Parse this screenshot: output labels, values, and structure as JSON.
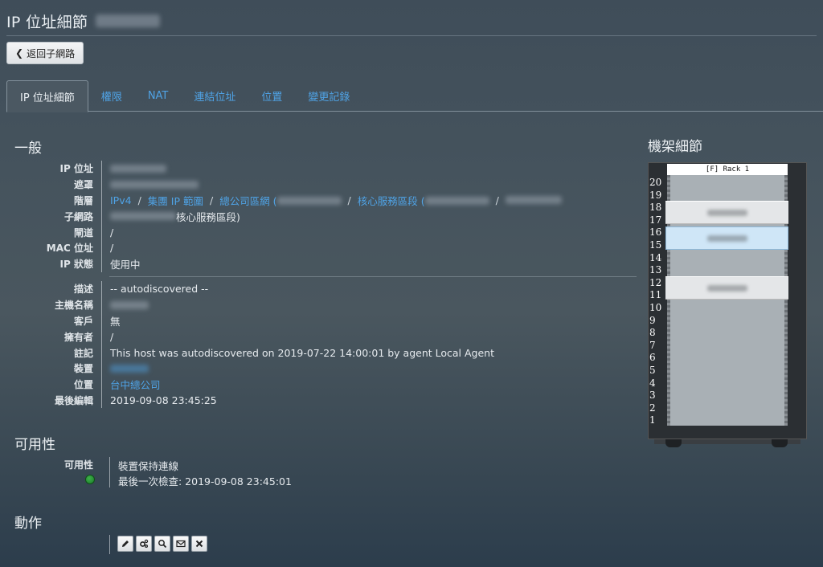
{
  "header": {
    "title": "IP 位址細節",
    "back_button_label": "返回子網路"
  },
  "tabs": [
    {
      "label": "IP 位址細節",
      "active": true
    },
    {
      "label": "權限",
      "active": false
    },
    {
      "label": "NAT",
      "active": false
    },
    {
      "label": "連結位址",
      "active": false
    },
    {
      "label": "位置",
      "active": false
    },
    {
      "label": "變更記錄",
      "active": false
    }
  ],
  "general": {
    "heading": "一般",
    "fields": {
      "ip_label": "IP 位址",
      "mask_label": "遮罩",
      "hierarchy_label": "階層",
      "subnet_label": "子網路",
      "gateway_label": "閘道",
      "gateway_value": "/",
      "mac_label": "MAC 位址",
      "mac_value": "/",
      "ipstate_label": "IP 狀態",
      "ipstate_value": "使用中",
      "description_label": "描述",
      "description_value": "-- autodiscovered --",
      "hostname_label": "主機名稱",
      "customer_label": "客戶",
      "customer_value": "無",
      "owner_label": "擁有者",
      "owner_value": "/",
      "note_label": "註記",
      "note_value": "This host was autodiscovered on 2019-07-22 14:00:01 by agent Local Agent",
      "device_label": "裝置",
      "location_label": "位置",
      "location_value": "台中總公司",
      "lastedit_label": "最後編輯",
      "lastedit_value": "2019-09-08 23:45:25"
    },
    "hierarchy": {
      "item1": "IPv4",
      "item2": "集團 IP 範圍",
      "item3": "總公司區網 (",
      "item4": "核心服務區段 (",
      "separator": "/"
    },
    "subnet_suffix": "核心服務區段)"
  },
  "availability": {
    "heading": "可用性",
    "label": "可用性",
    "status_text": "裝置保持連線",
    "last_check": "最後一次檢查: 2019-09-08 23:45:01",
    "status_color": "#2e9e3c"
  },
  "actions": {
    "heading": "動作",
    "buttons": [
      "edit-icon",
      "settings-icon",
      "search-icon",
      "mail-icon",
      "close-icon"
    ]
  },
  "rack": {
    "title": "機架細節",
    "name": "[F] Rack 1",
    "units": [
      "20",
      "19",
      "18",
      "17",
      "16",
      "15",
      "14",
      "13",
      "12",
      "11",
      "10",
      "9",
      "8",
      "7",
      "6",
      "5",
      "4",
      "3",
      "2",
      "1"
    ],
    "colors": {
      "accent": "#4fa3e6",
      "device_grey": "#e4e6e8",
      "device_blue": "#cfe6f7"
    }
  }
}
